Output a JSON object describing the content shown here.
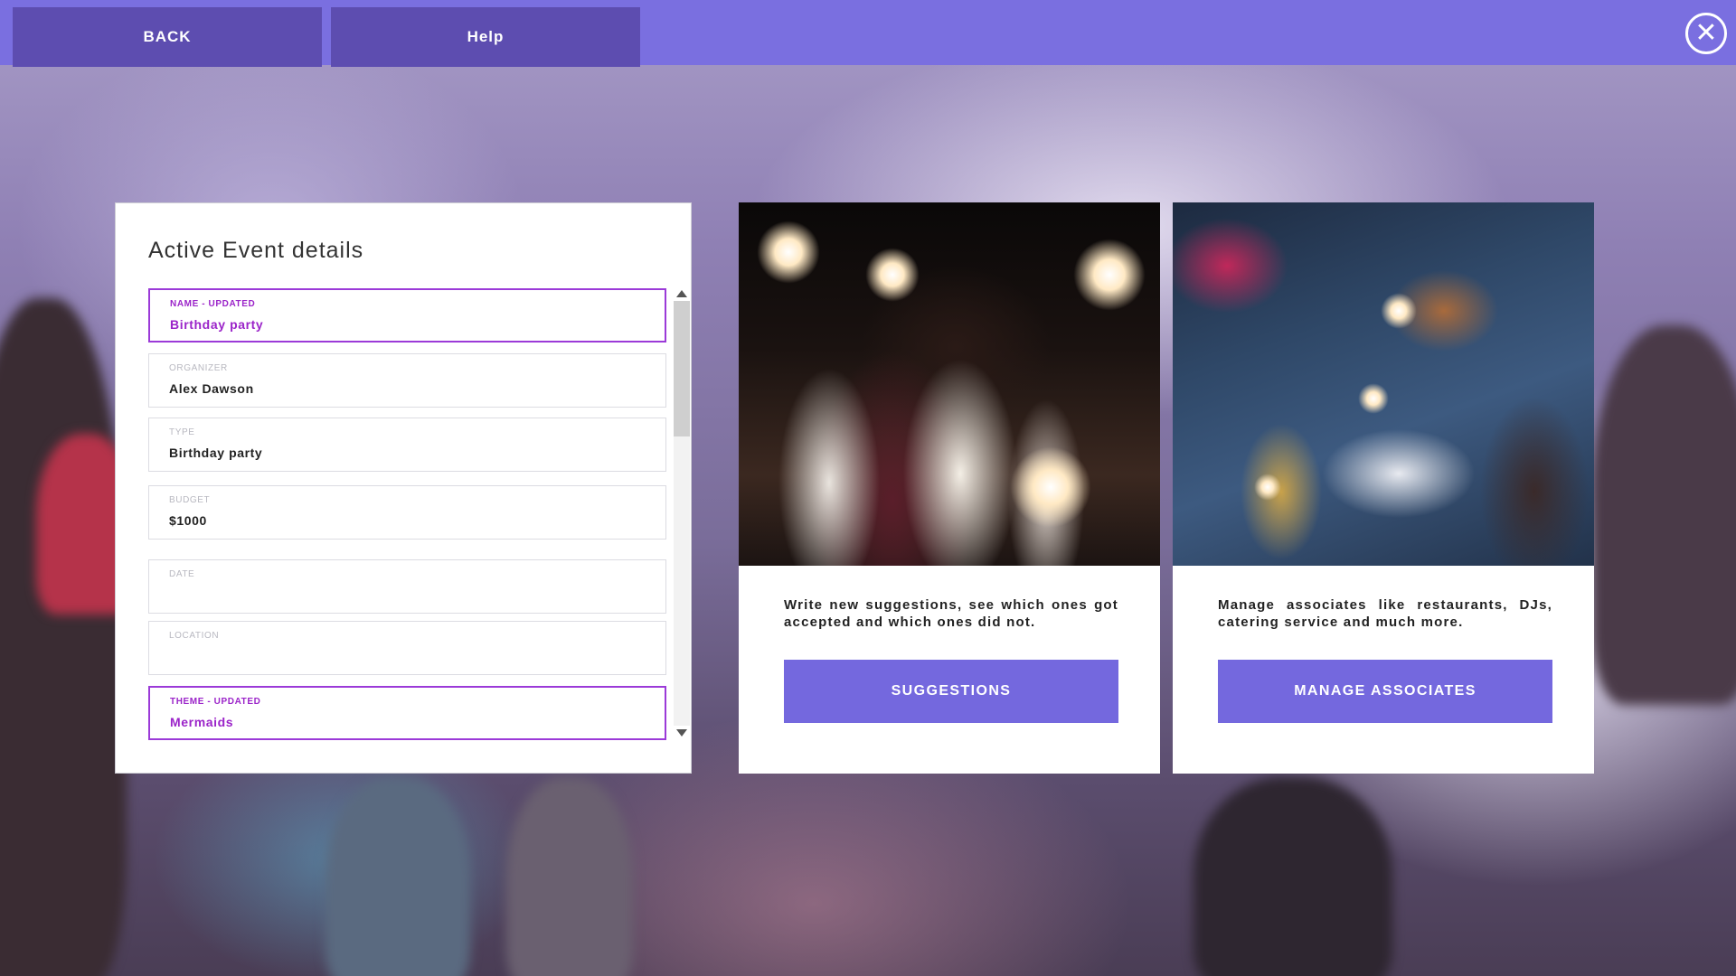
{
  "topbar": {
    "back_label": "BACK",
    "help_label": "Help",
    "close_icon": "close-circle-icon"
  },
  "event_panel": {
    "title": "Active Event details",
    "fields": [
      {
        "label": "NAME - UPDATED",
        "value": "Birthday party",
        "updated": true
      },
      {
        "label": "ORGANIZER",
        "value": "Alex Dawson",
        "updated": false
      },
      {
        "label": "TYPE",
        "value": "Birthday party",
        "updated": false
      },
      {
        "label": "BUDGET",
        "value": "$1000",
        "updated": false
      },
      {
        "label": "DATE",
        "value": "",
        "updated": false
      },
      {
        "label": "LOCATION",
        "value": "",
        "updated": false
      },
      {
        "label": "THEME - UPDATED",
        "value": "Mermaids",
        "updated": true
      }
    ]
  },
  "cards": {
    "suggestions": {
      "description": "Write new suggestions, see which ones got accepted and which ones did not.",
      "button_label": "SUGGESTIONS"
    },
    "associates": {
      "description": "Manage associates like restaurants, DJs, catering service and much more.",
      "button_label": "MANAGE ASSOCIATES"
    }
  },
  "colors": {
    "topbar": "#7a6fe0",
    "top_button": "#5d4db0",
    "accent_button": "#7468de",
    "updated_field": "#9b24c9"
  }
}
